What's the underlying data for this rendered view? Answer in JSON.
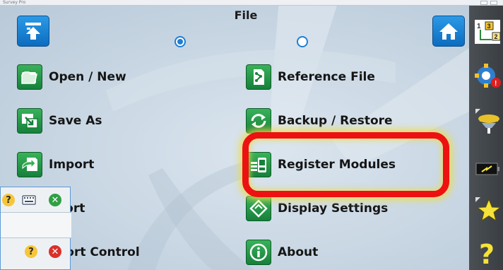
{
  "window": {
    "app_title": "Survey Pro"
  },
  "page": {
    "title": "File"
  },
  "pager": {
    "dots": [
      "page-1",
      "page-2"
    ],
    "active_index": 0
  },
  "menu": {
    "left": [
      {
        "label": "Open / New"
      },
      {
        "label": "Save As"
      },
      {
        "label": "Import"
      },
      {
        "label": "xport"
      },
      {
        "label": "nport Control"
      }
    ],
    "right": [
      {
        "label": "Reference File"
      },
      {
        "label": "Backup / Restore"
      },
      {
        "label": "Register Modules"
      },
      {
        "label": "Display Settings"
      },
      {
        "label": "About"
      }
    ]
  },
  "highlight": {
    "target": "Register Modules",
    "color": "#ee1111"
  },
  "sidebar": {
    "icons": [
      "grid-numbers-icon",
      "settings-alert-icon",
      "instrument-icon",
      "battery-icon",
      "favorites-star-icon",
      "help-icon"
    ]
  },
  "popup": {
    "icons": [
      "help-icon",
      "keyboard-icon",
      "close-green-icon",
      "help-icon",
      "close-red-icon"
    ]
  },
  "colors": {
    "accent_blue": "#1f7fd4",
    "tile_green": "#2a9a4a",
    "sidebar": "#43474b",
    "star": "#f6e23a"
  }
}
